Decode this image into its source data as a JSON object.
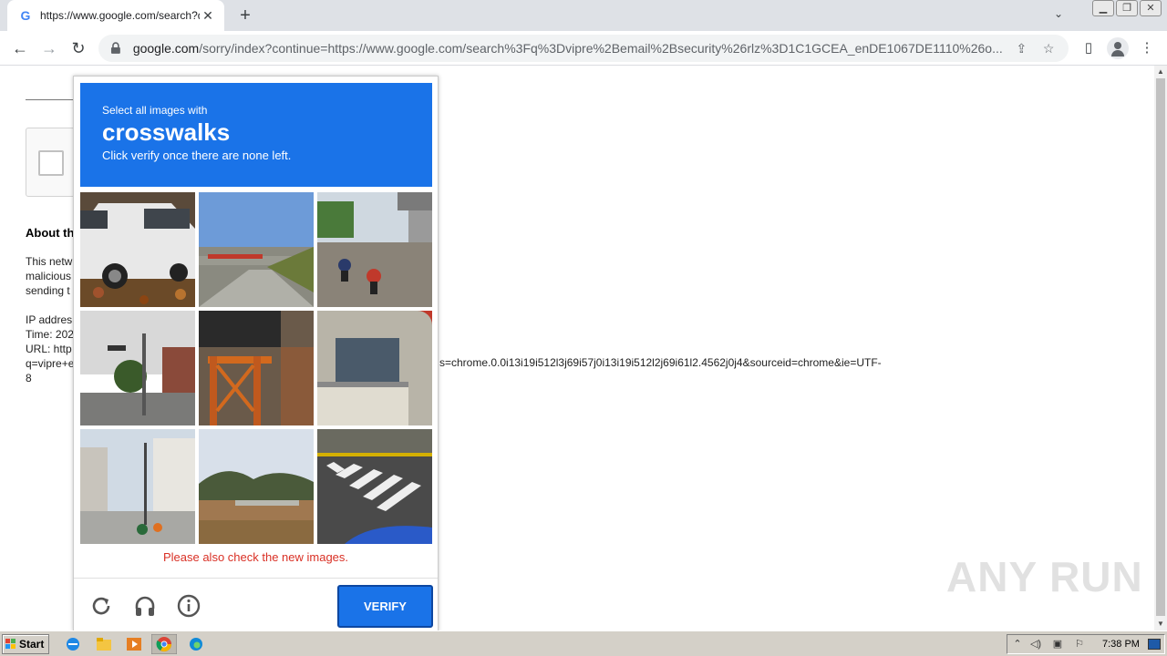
{
  "browser": {
    "tab_title": "https://www.google.com/search?q=",
    "tab_favicon": "G",
    "tab_close": "✕",
    "new_tab": "+",
    "url_host": "google.com",
    "url_rest": "/sorry/index?continue=https://www.google.com/search%3Fq%3Dvipre%2Bemail%2Bsecurity%26rlz%3D1C1GCEA_enDE1067DE1110%26o...",
    "back": "←",
    "forward": "→",
    "reload": "↻"
  },
  "page": {
    "about_heading": "About th",
    "lines": [
      "This netw",
      "malicious",
      "sending t",
      "",
      "IP addres",
      "Time: 202",
      "URL: http",
      "q=vipre+e",
      "8"
    ],
    "url_tail": "s=chrome.0.0i13i19i512l3j69i57j0i13i19i512l2j69i61l2.4562j0j4&sourceid=chrome&ie=UTF-"
  },
  "captcha": {
    "prompt_small": "Select all images with",
    "prompt_target": "crosswalks",
    "prompt_sub": "Click verify once there are none left.",
    "error": "Please also check the new images.",
    "verify_label": "VERIFY",
    "tiles": [
      "white-suv-car",
      "highway-overpass",
      "motorcycles-road",
      "street-corner-houses",
      "orange-scaffold",
      "building-balcony",
      "urban-street",
      "dry-field",
      "crosswalk-road"
    ]
  },
  "watermark": "ANY RUN",
  "taskbar": {
    "start_label": "Start",
    "clock": "7:38 PM"
  }
}
